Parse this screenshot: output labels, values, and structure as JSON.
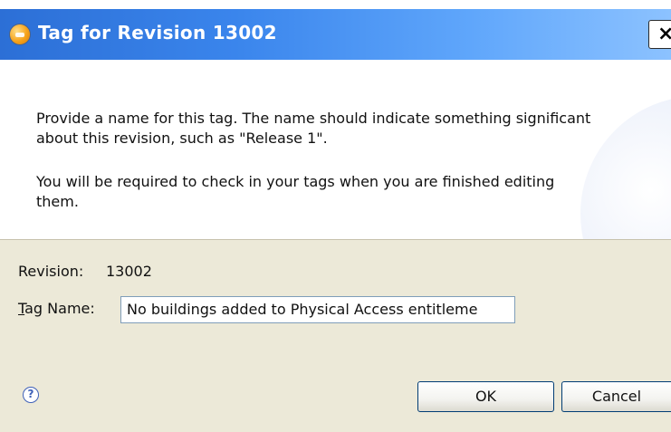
{
  "window": {
    "title": "Tag for Revision 13002",
    "icon": "app-orange-icon",
    "close_glyph": "×"
  },
  "header": {
    "message_1": "Provide a name for this tag.  The name should indicate something significant about this revision, such as \"Release 1\".",
    "message_2": "You will be required to check in your tags when you are finished editing them."
  },
  "form": {
    "revision_label": "Revision:",
    "revision_value": "13002",
    "tag_name_label_mnemonic": "T",
    "tag_name_label_rest": "ag Name:",
    "tag_name_value": "No buildings added to Physical Access entitleme"
  },
  "footer": {
    "help_glyph": "?",
    "ok_label": "OK",
    "cancel_label": "Cancel"
  },
  "colors": {
    "titlebar": "#3a85ec",
    "dialog_background": "#ece9d8",
    "header_background": "#ffffff"
  }
}
